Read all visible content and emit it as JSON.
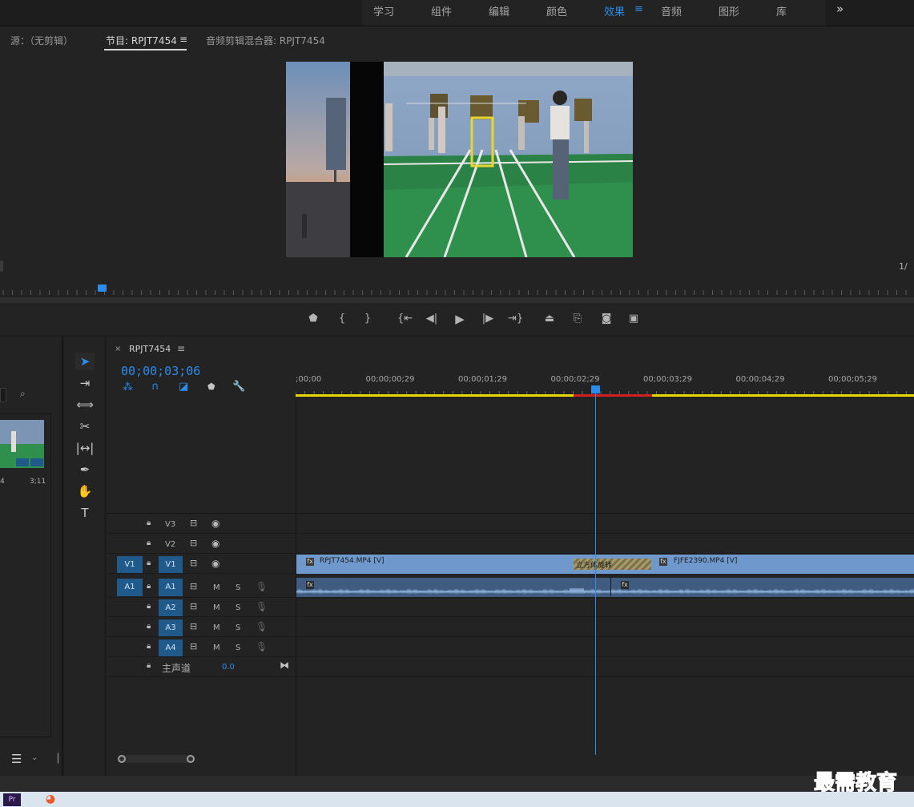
{
  "workspaces": {
    "tabs": [
      "学习",
      "组件",
      "编辑",
      "颜色",
      "效果",
      "音频",
      "图形",
      "库"
    ],
    "active": "效果",
    "more": "»"
  },
  "monitor_panel": {
    "source_tab": "源：（无剪辑）",
    "program_tab": "节目: RPJT7454",
    "mixer_tab": "音频剪辑混合器: RPJT7454",
    "fraction_label": "1/"
  },
  "timeline": {
    "sequence_tab": "RPJT7454",
    "close": "×",
    "timecode": "00;00;03;06",
    "ruler_labels": [
      ";00;00",
      "00;00;00;29",
      "00;00;01;29",
      "00;00;02;29",
      "00;00;03;29",
      "00;00;04;29",
      "00;00;05;29"
    ],
    "video_tracks": [
      {
        "src": "",
        "name": "V3"
      },
      {
        "src": "",
        "name": "V2"
      },
      {
        "src": "V1",
        "name": "V1"
      }
    ],
    "audio_tracks": [
      {
        "src": "A1",
        "name": "A1"
      },
      {
        "src": "",
        "name": "A2"
      },
      {
        "src": "",
        "name": "A3"
      },
      {
        "src": "",
        "name": "A4"
      }
    ],
    "mute_label": "M",
    "solo_label": "S",
    "master_label": "主声道",
    "master_value": "0.0",
    "clips": {
      "clip1": "RPJT7454.MP4 [V]",
      "transition": "立方体旋转",
      "clip2": "FJFE2390.MP4 [V]"
    }
  },
  "project_panel": {
    "thumb_in": "4",
    "thumb_out": "3;11"
  },
  "watermark": "最需教育",
  "colors": {
    "accent": "#2d8ceb",
    "clip_video": "#6f98cc",
    "clip_audio": "#3f5b80",
    "playhead": "#2d8ceb",
    "work_area": "#e5d800",
    "render_red": "#d02020"
  }
}
